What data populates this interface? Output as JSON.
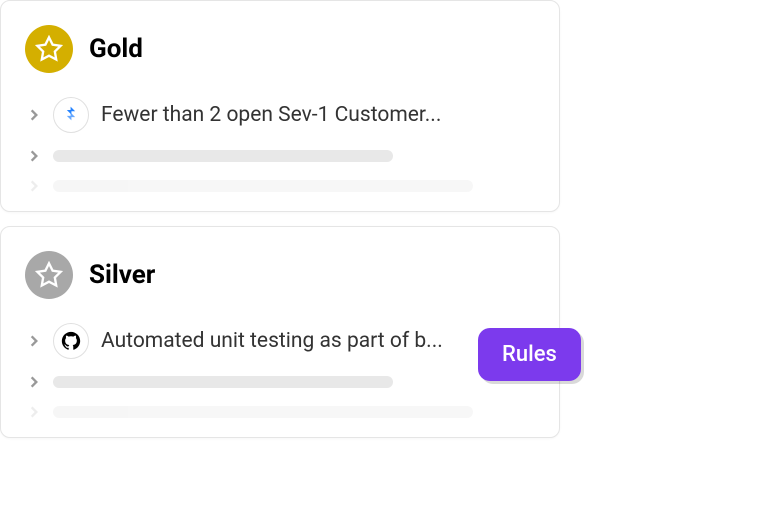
{
  "tiers": {
    "gold": {
      "title": "Gold",
      "rule_text": "Fewer than 2 open Sev-1 Customer..."
    },
    "silver": {
      "title": "Silver",
      "rule_text": "Automated unit testing as part of b..."
    }
  },
  "badge": {
    "label": "Rules"
  },
  "colors": {
    "gold": "#d4af00",
    "silver": "#a8a8a8",
    "accent": "#7c3aed"
  }
}
